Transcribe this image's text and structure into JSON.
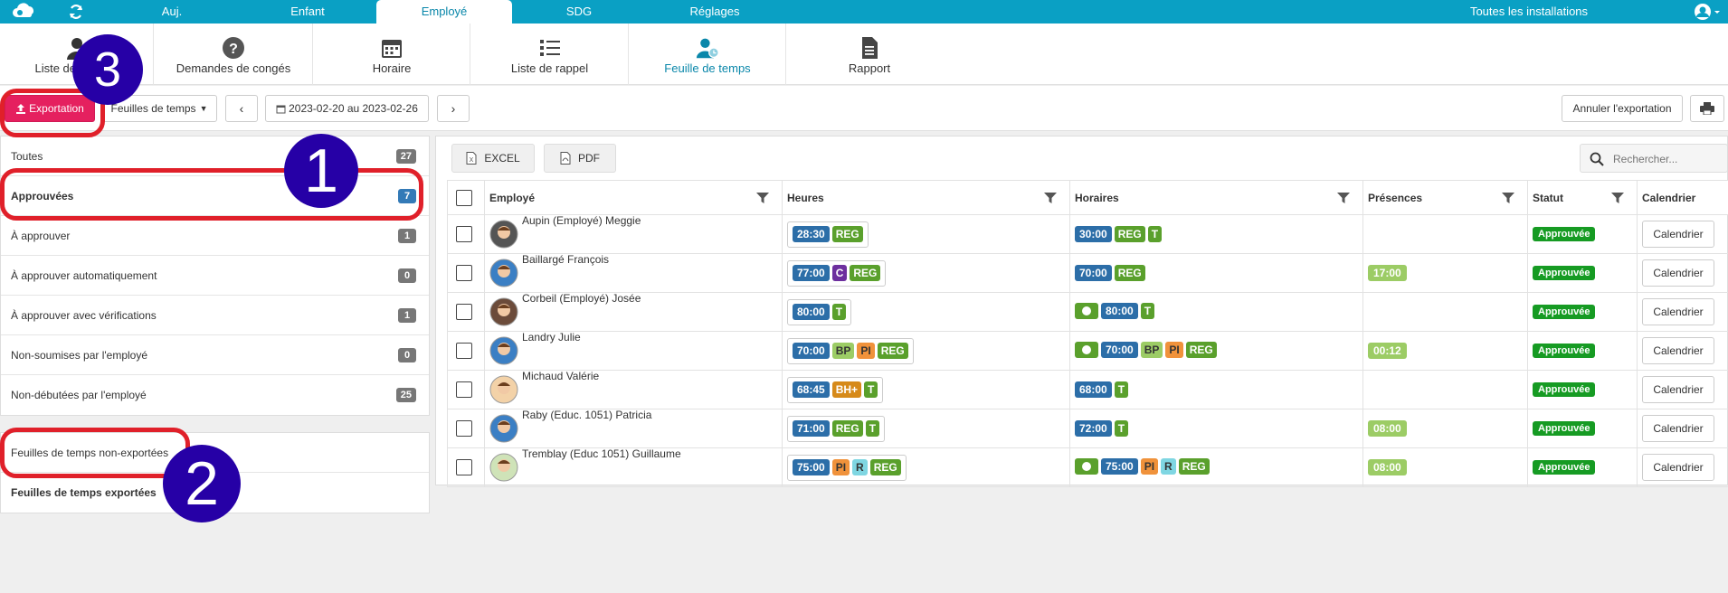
{
  "topnav": {
    "tabs": [
      "Auj.",
      "Enfant",
      "Employé",
      "SDG",
      "Réglages"
    ],
    "installations": "Toutes les installations"
  },
  "subnav": {
    "tabs": [
      "Liste des",
      "Demandes de congés",
      "Horaire",
      "Liste de rappel",
      "Feuille de temps",
      "Rapport"
    ]
  },
  "toolbar": {
    "export_label": "Exportation",
    "view_label": "Feuilles de temps",
    "date_range": "2023-02-20 au 2023-02-26",
    "cancel_export_label": "Annuler l'exportation"
  },
  "filters": [
    {
      "label": "Toutes",
      "count": "27"
    },
    {
      "label": "Approuvées",
      "count": "7"
    },
    {
      "label": "À approuver",
      "count": "1"
    },
    {
      "label": "À approuver automatiquement",
      "count": "0"
    },
    {
      "label": "À approuver avec vérifications",
      "count": "1"
    },
    {
      "label": "Non-soumises par l'employé",
      "count": "0"
    },
    {
      "label": "Non-débutées par l'employé",
      "count": "25"
    }
  ],
  "export_filters": [
    "Feuilles de temps non-exportées",
    "Feuilles de temps exportées"
  ],
  "grid": {
    "excel_label": "EXCEL",
    "pdf_label": "PDF",
    "search_placeholder": "Rechercher...",
    "columns": [
      "Employé",
      "Heures",
      "Horaires",
      "Présences",
      "Statut",
      "Calendrier"
    ],
    "calendar_button": "Calendrier",
    "rows": [
      {
        "name": "Aupin (Employé) Meggie",
        "hours": "28:30",
        "hour_tags": [
          "REG"
        ],
        "sched_toggle": false,
        "sched": "30:00",
        "sched_tags": [
          "REG",
          "T"
        ],
        "presence": "",
        "status": "Approuvée"
      },
      {
        "name": "Baillargé François",
        "hours": "77:00",
        "hour_tags": [
          "C",
          "REG"
        ],
        "sched_toggle": false,
        "sched": "70:00",
        "sched_tags": [
          "REG"
        ],
        "presence": "17:00",
        "status": "Approuvée"
      },
      {
        "name": "Corbeil (Employé) Josée",
        "hours": "80:00",
        "hour_tags": [
          "T"
        ],
        "sched_toggle": true,
        "sched": "80:00",
        "sched_tags": [
          "T"
        ],
        "presence": "",
        "status": "Approuvée"
      },
      {
        "name": "Landry Julie",
        "hours": "70:00",
        "hour_tags": [
          "BP",
          "PI",
          "REG"
        ],
        "sched_toggle": true,
        "sched": "70:00",
        "sched_tags": [
          "BP",
          "PI",
          "REG"
        ],
        "presence": "00:12",
        "status": "Approuvée"
      },
      {
        "name": "Michaud Valérie",
        "hours": "68:45",
        "hour_tags": [
          "BH+",
          "T"
        ],
        "sched_toggle": false,
        "sched": "68:00",
        "sched_tags": [
          "T"
        ],
        "presence": "",
        "status": "Approuvée"
      },
      {
        "name": "Raby (Educ. 1051) Patricia",
        "hours": "71:00",
        "hour_tags": [
          "REG",
          "T"
        ],
        "sched_toggle": false,
        "sched": "72:00",
        "sched_tags": [
          "T"
        ],
        "presence": "08:00",
        "status": "Approuvée"
      },
      {
        "name": "Tremblay (Educ 1051) Guillaume",
        "hours": "75:00",
        "hour_tags": [
          "PI",
          "R",
          "REG"
        ],
        "sched_toggle": true,
        "sched": "75:00",
        "sched_tags": [
          "PI",
          "R",
          "REG"
        ],
        "presence": "08:00",
        "status": "Approuvée"
      }
    ]
  },
  "annotations": [
    "1",
    "2",
    "3"
  ],
  "colors": {
    "topnav": "#0aa0c4",
    "accent_export": "#e5205f",
    "status_approved": "#169b23",
    "marker": "#2600a6",
    "ring": "#e0202a"
  }
}
